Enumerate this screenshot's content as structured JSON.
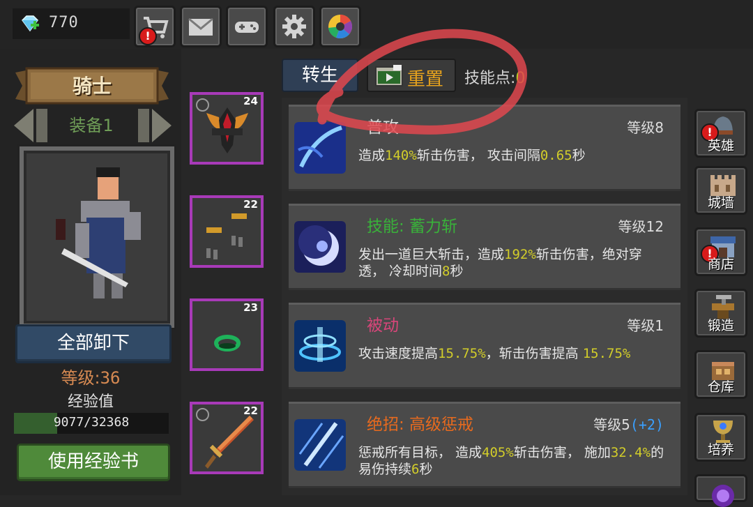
{
  "topbar": {
    "gems": "770",
    "buttons": [
      {
        "name": "shop-cart",
        "icon": "cart-icon",
        "alert": "!"
      },
      {
        "name": "mail",
        "icon": "envelope-icon"
      },
      {
        "name": "gamepad",
        "icon": "gamepad-icon"
      },
      {
        "name": "settings",
        "icon": "gear-icon"
      },
      {
        "name": "color-wheel",
        "icon": "color-wheel-icon"
      }
    ]
  },
  "hero": {
    "class_title": "骑士",
    "equip_set": "装备1",
    "unequip_all": "全部卸下",
    "level_label": "等级:",
    "level_value": "36",
    "exp_label": "经验值",
    "exp_text": "9077/32368",
    "exp_fraction": 0.2804,
    "use_exp_book": "使用经验书"
  },
  "equipment": [
    {
      "level": "24",
      "icon": "demon-helmet-icon",
      "ring": true
    },
    {
      "level": "22",
      "icon": "gauntlets-icon",
      "ring": false
    },
    {
      "level": "23",
      "icon": "green-ring-icon",
      "ring": false
    },
    {
      "level": "22",
      "icon": "sword-icon",
      "ring": true
    }
  ],
  "tabs": {
    "rebirth": "转生",
    "reset": "重置",
    "skill_points_label": "技能点:",
    "skill_points_value": "0"
  },
  "skills": [
    {
      "name": "普攻",
      "name_color": "#e0e0e0",
      "level": "等级8",
      "bonus": "",
      "desc": [
        {
          "t": "造成"
        },
        {
          "t": "140%",
          "h": true
        },
        {
          "t": "斩击伤害， 攻击间隔"
        },
        {
          "t": "0.65",
          "h": true
        },
        {
          "t": "秒"
        }
      ]
    },
    {
      "name": "技能: 蓄力斩",
      "name_color": "#39b13a",
      "level": "等级12",
      "bonus": "",
      "desc": [
        {
          "t": "发出一道巨大斩击，造成"
        },
        {
          "t": "192%",
          "h": true
        },
        {
          "t": "斩击伤害，绝对穿透， 冷却时间"
        },
        {
          "t": "8",
          "h": true
        },
        {
          "t": "秒"
        }
      ]
    },
    {
      "name": "被动",
      "name_color": "#d8467a",
      "level": "等级1",
      "bonus": "",
      "desc": [
        {
          "t": "攻击速度提高"
        },
        {
          "t": "15.75%",
          "h": true
        },
        {
          "t": "，斩击伤害提高 "
        },
        {
          "t": "15.75%",
          "h": true
        }
      ]
    },
    {
      "name": "绝招: 高级惩戒",
      "name_color": "#e86a1e",
      "level": "等级5",
      "bonus": "(+2)",
      "desc": [
        {
          "t": "惩戒所有目标， 造成"
        },
        {
          "t": "405%",
          "h": true
        },
        {
          "t": "斩击伤害， 施加"
        },
        {
          "t": "32.4%",
          "h": true
        },
        {
          "t": "的易伤持续"
        },
        {
          "t": "6",
          "h": true
        },
        {
          "t": "秒"
        }
      ]
    }
  ],
  "side_nav": [
    {
      "label": "英雄",
      "icon": "helmet-icon",
      "alert": "!"
    },
    {
      "label": "城墙",
      "icon": "wall-icon"
    },
    {
      "label": "商店",
      "icon": "shop-icon",
      "alert": "!"
    },
    {
      "label": "锻造",
      "icon": "anvil-icon"
    },
    {
      "label": "仓库",
      "icon": "warehouse-icon"
    },
    {
      "label": "培养",
      "icon": "chalice-icon"
    }
  ],
  "colors": {
    "rare_border": "#a83ab8",
    "highlight": "#d2cd2a",
    "reset_label": "#e6a21d"
  }
}
